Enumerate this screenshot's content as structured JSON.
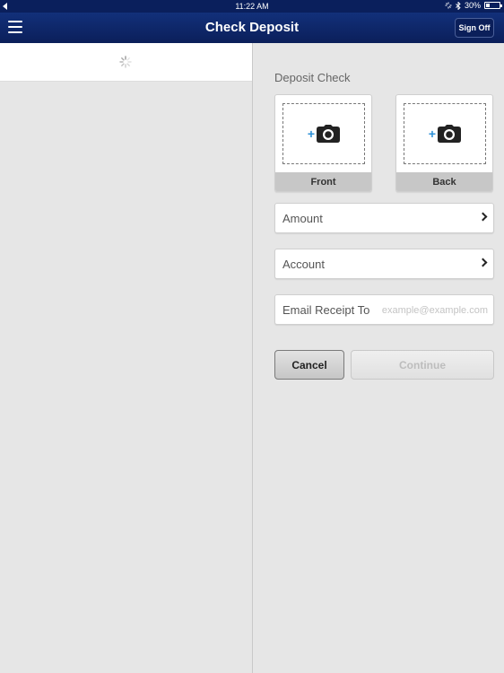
{
  "status_bar": {
    "time": "11:22 AM",
    "battery": "30%",
    "battery_level": 0.3
  },
  "nav": {
    "title": "Check Deposit",
    "sign_off_label": "Sign Off"
  },
  "form": {
    "section_title": "Deposit Check",
    "front_label": "Front",
    "back_label": "Back",
    "amount_label": "Amount",
    "account_label": "Account",
    "email_label": "Email Receipt To",
    "email_placeholder": "example@example.com",
    "email_value": "",
    "cancel_label": "Cancel",
    "continue_label": "Continue"
  },
  "colors": {
    "nav_bar": "#0b1f5a",
    "accent_plus": "#2b8fd6",
    "panel_bg": "#e6e6e6"
  },
  "icons": {
    "menu": "hamburger-icon",
    "camera": "camera-icon",
    "plus": "plus-icon",
    "chevron": "chevron-right-icon",
    "spinner": "loading-spinner-icon"
  }
}
